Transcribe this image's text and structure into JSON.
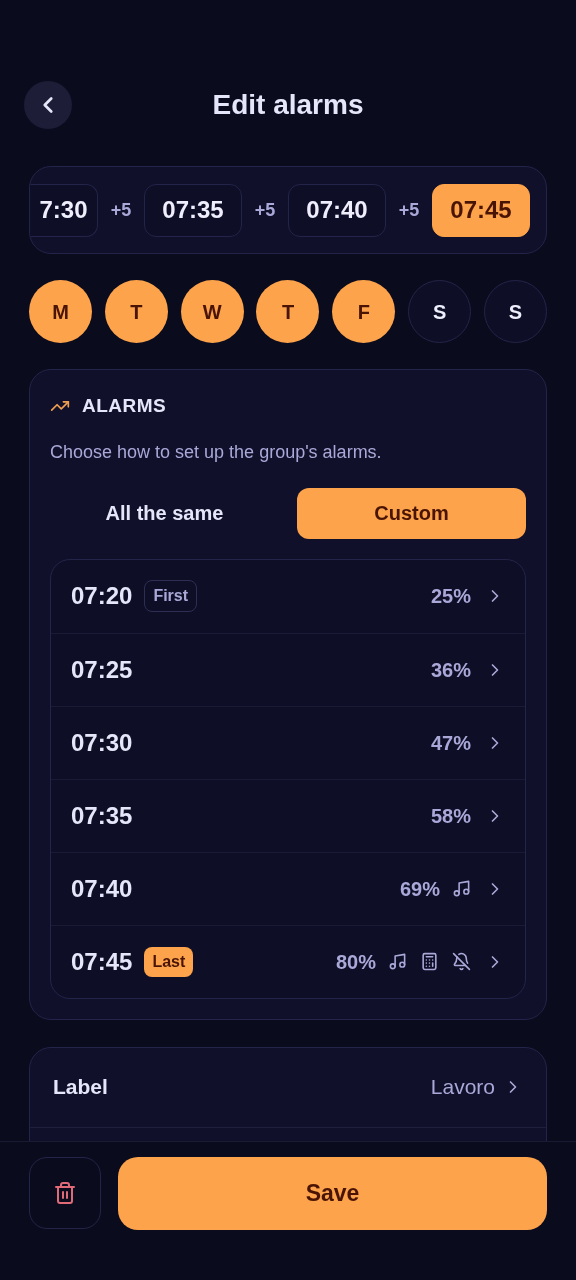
{
  "header": {
    "title": "Edit alarms"
  },
  "sequence": [
    {
      "time": "7:30",
      "selected": false,
      "cut": true
    },
    {
      "time": "07:35",
      "selected": false,
      "cut": false
    },
    {
      "time": "07:40",
      "selected": false,
      "cut": false
    },
    {
      "time": "07:45",
      "selected": true,
      "cut": false
    }
  ],
  "steps": [
    "+5",
    "+5",
    "+5"
  ],
  "days": [
    {
      "label": "M",
      "selected": true
    },
    {
      "label": "T",
      "selected": true
    },
    {
      "label": "W",
      "selected": true
    },
    {
      "label": "T",
      "selected": true
    },
    {
      "label": "F",
      "selected": true
    },
    {
      "label": "S",
      "selected": false
    },
    {
      "label": "S",
      "selected": false
    }
  ],
  "alarms_section": {
    "title": "ALARMS",
    "description": "Choose how to set up the group's alarms.",
    "modes": [
      {
        "label": "All the same",
        "selected": false
      },
      {
        "label": "Custom",
        "selected": true
      }
    ],
    "alarms": [
      {
        "time": "07:20",
        "badge": {
          "text": "First",
          "highlighted": false
        },
        "volume": "25%",
        "sound": false,
        "puzzle": false,
        "silenced": false
      },
      {
        "time": "07:25",
        "volume": "36%",
        "sound": false,
        "puzzle": false,
        "silenced": false
      },
      {
        "time": "07:30",
        "volume": "47%",
        "sound": false,
        "puzzle": false,
        "silenced": false
      },
      {
        "time": "07:35",
        "volume": "58%",
        "sound": false,
        "puzzle": false,
        "silenced": false
      },
      {
        "time": "07:40",
        "volume": "69%",
        "sound": true,
        "puzzle": false,
        "silenced": false
      },
      {
        "time": "07:45",
        "badge": {
          "text": "Last",
          "highlighted": true
        },
        "volume": "80%",
        "sound": true,
        "puzzle": true,
        "silenced": true
      }
    ]
  },
  "settings": [
    {
      "label": "Label",
      "value": "Lavoro"
    }
  ],
  "footer": {
    "save": "Save"
  }
}
